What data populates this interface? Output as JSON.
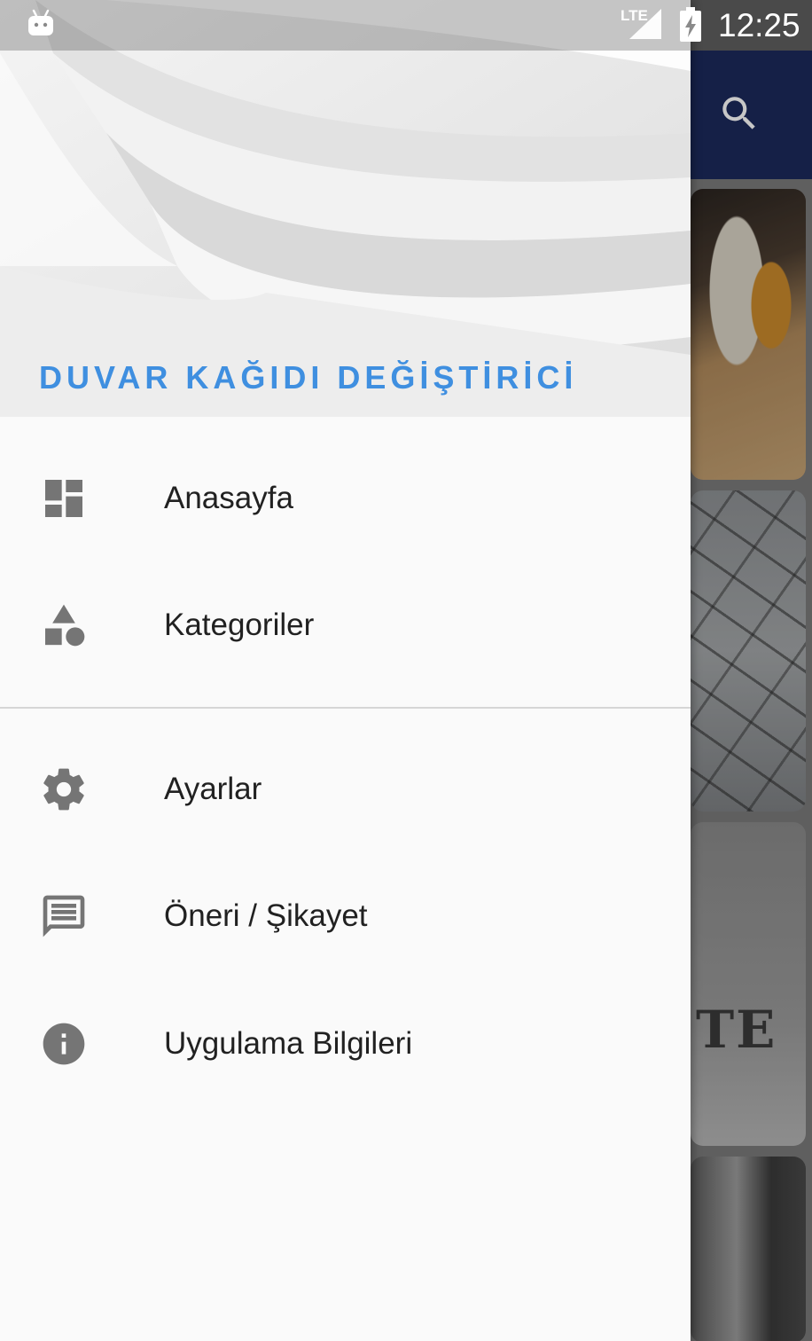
{
  "status_bar": {
    "network": "LTE",
    "time": "12:25"
  },
  "drawer": {
    "title": "DUVAR KAĞIDI DEĞİŞTİRİCİ",
    "primary_items": [
      {
        "label": "Anasayfa",
        "icon": "dashboard-icon"
      },
      {
        "label": "Kategoriler",
        "icon": "category-icon"
      }
    ],
    "secondary_items": [
      {
        "label": "Ayarlar",
        "icon": "settings-gear-icon"
      },
      {
        "label": "Öneri / Şikayet",
        "icon": "feedback-message-icon"
      },
      {
        "label": "Uygulama Bilgileri",
        "icon": "info-icon"
      }
    ]
  },
  "background": {
    "toolbar_color": "#1c2a5c",
    "visible_card_text": "TE"
  },
  "colors": {
    "accent_title": "#3f8fe0",
    "menu_icon": "#757575",
    "menu_text": "#212121"
  }
}
